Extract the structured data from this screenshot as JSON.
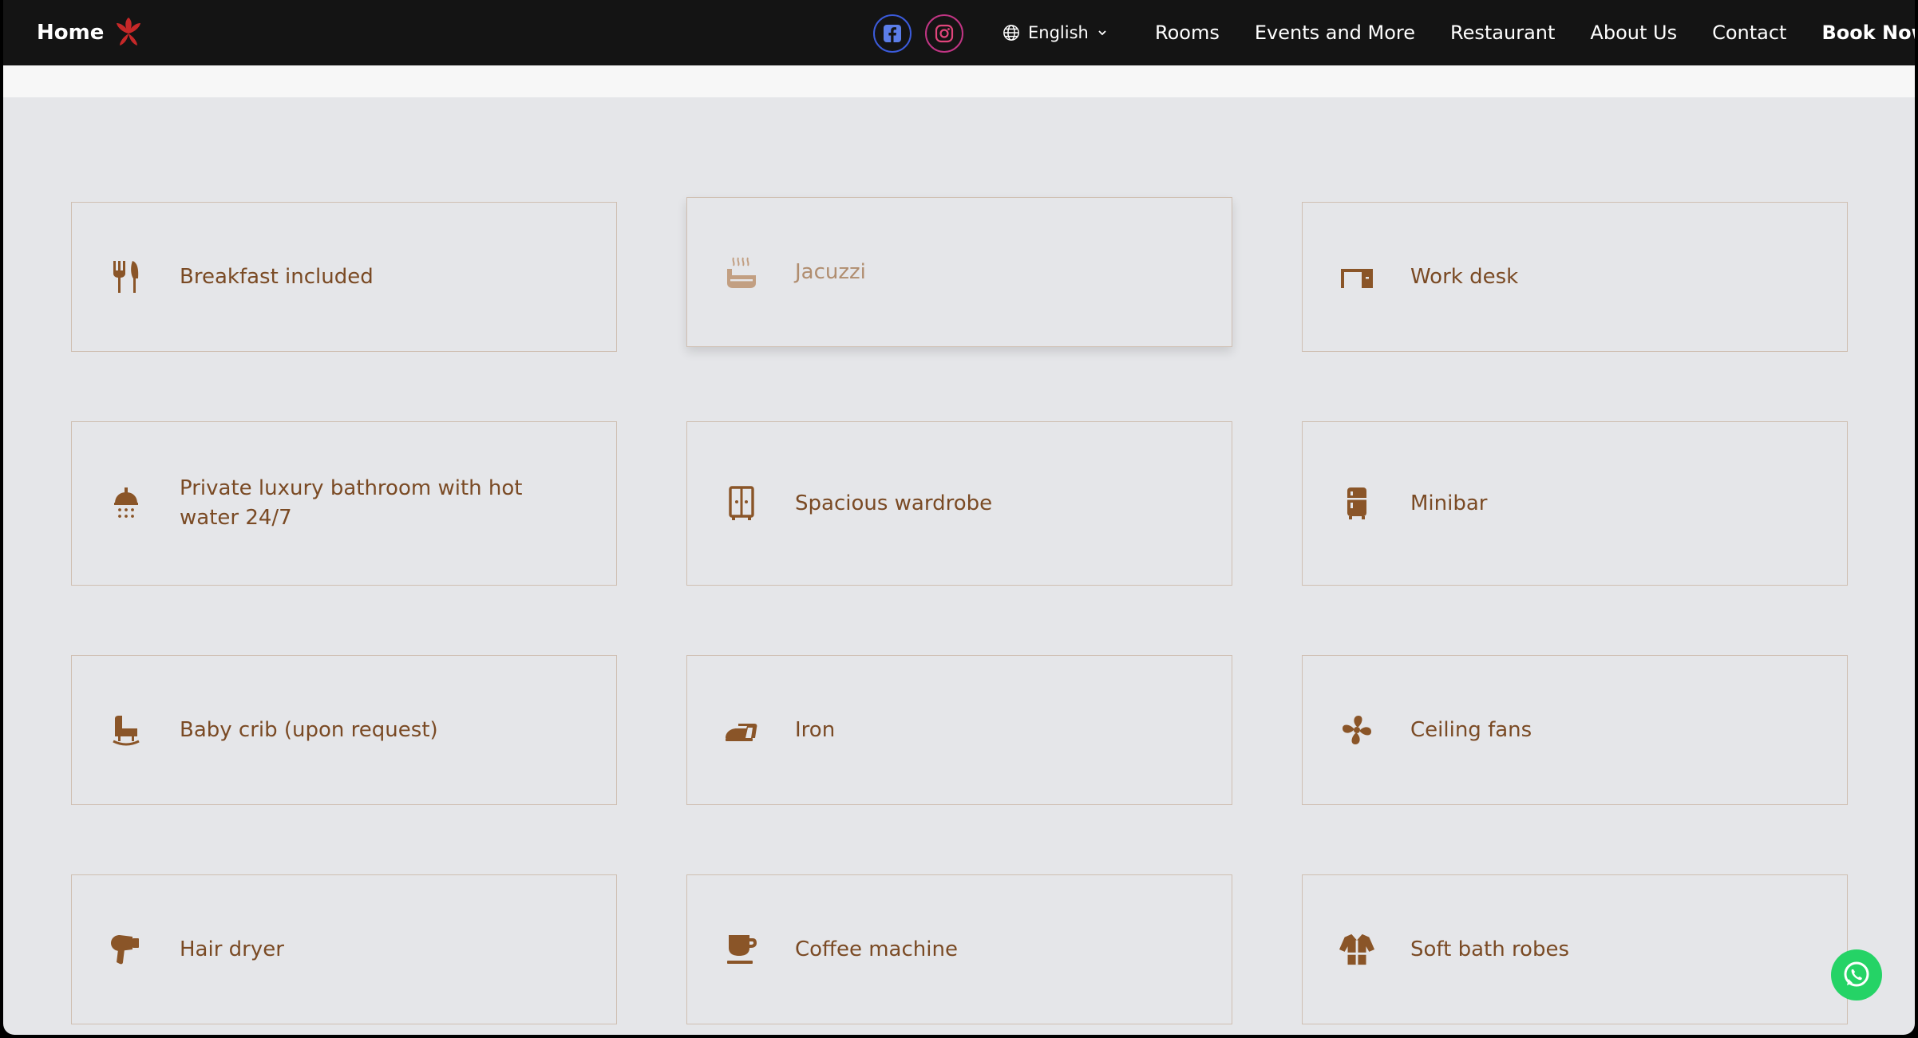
{
  "nav": {
    "brand": "Home",
    "language": "English",
    "items": [
      "Rooms",
      "Events and More",
      "Restaurant",
      "About Us",
      "Contact"
    ],
    "book_now": "Book Now"
  },
  "amenities": [
    {
      "label": "Breakfast included",
      "icon": "utensils-icon"
    },
    {
      "label": "Jacuzzi",
      "icon": "hot-tub-icon"
    },
    {
      "label": "Work desk",
      "icon": "desk-icon"
    },
    {
      "label": "Private luxury bathroom with hot water 24/7",
      "icon": "shower-icon"
    },
    {
      "label": "Spacious wardrobe",
      "icon": "wardrobe-icon"
    },
    {
      "label": "Minibar",
      "icon": "minibar-icon"
    },
    {
      "label": "Baby crib (upon request)",
      "icon": "baby-crib-icon"
    },
    {
      "label": "Iron",
      "icon": "iron-icon"
    },
    {
      "label": "Ceiling fans",
      "icon": "fan-icon"
    },
    {
      "label": "Hair dryer",
      "icon": "hair-dryer-icon"
    },
    {
      "label": "Coffee machine",
      "icon": "coffee-icon"
    },
    {
      "label": "Soft bath robes",
      "icon": "bathrobe-icon"
    }
  ],
  "colors": {
    "nav_bg": "#141414",
    "page_bg": "#e5e6e9",
    "accent_brown": "#7a4a24",
    "card_border": "#cfbfb2",
    "whatsapp": "#25d366"
  }
}
